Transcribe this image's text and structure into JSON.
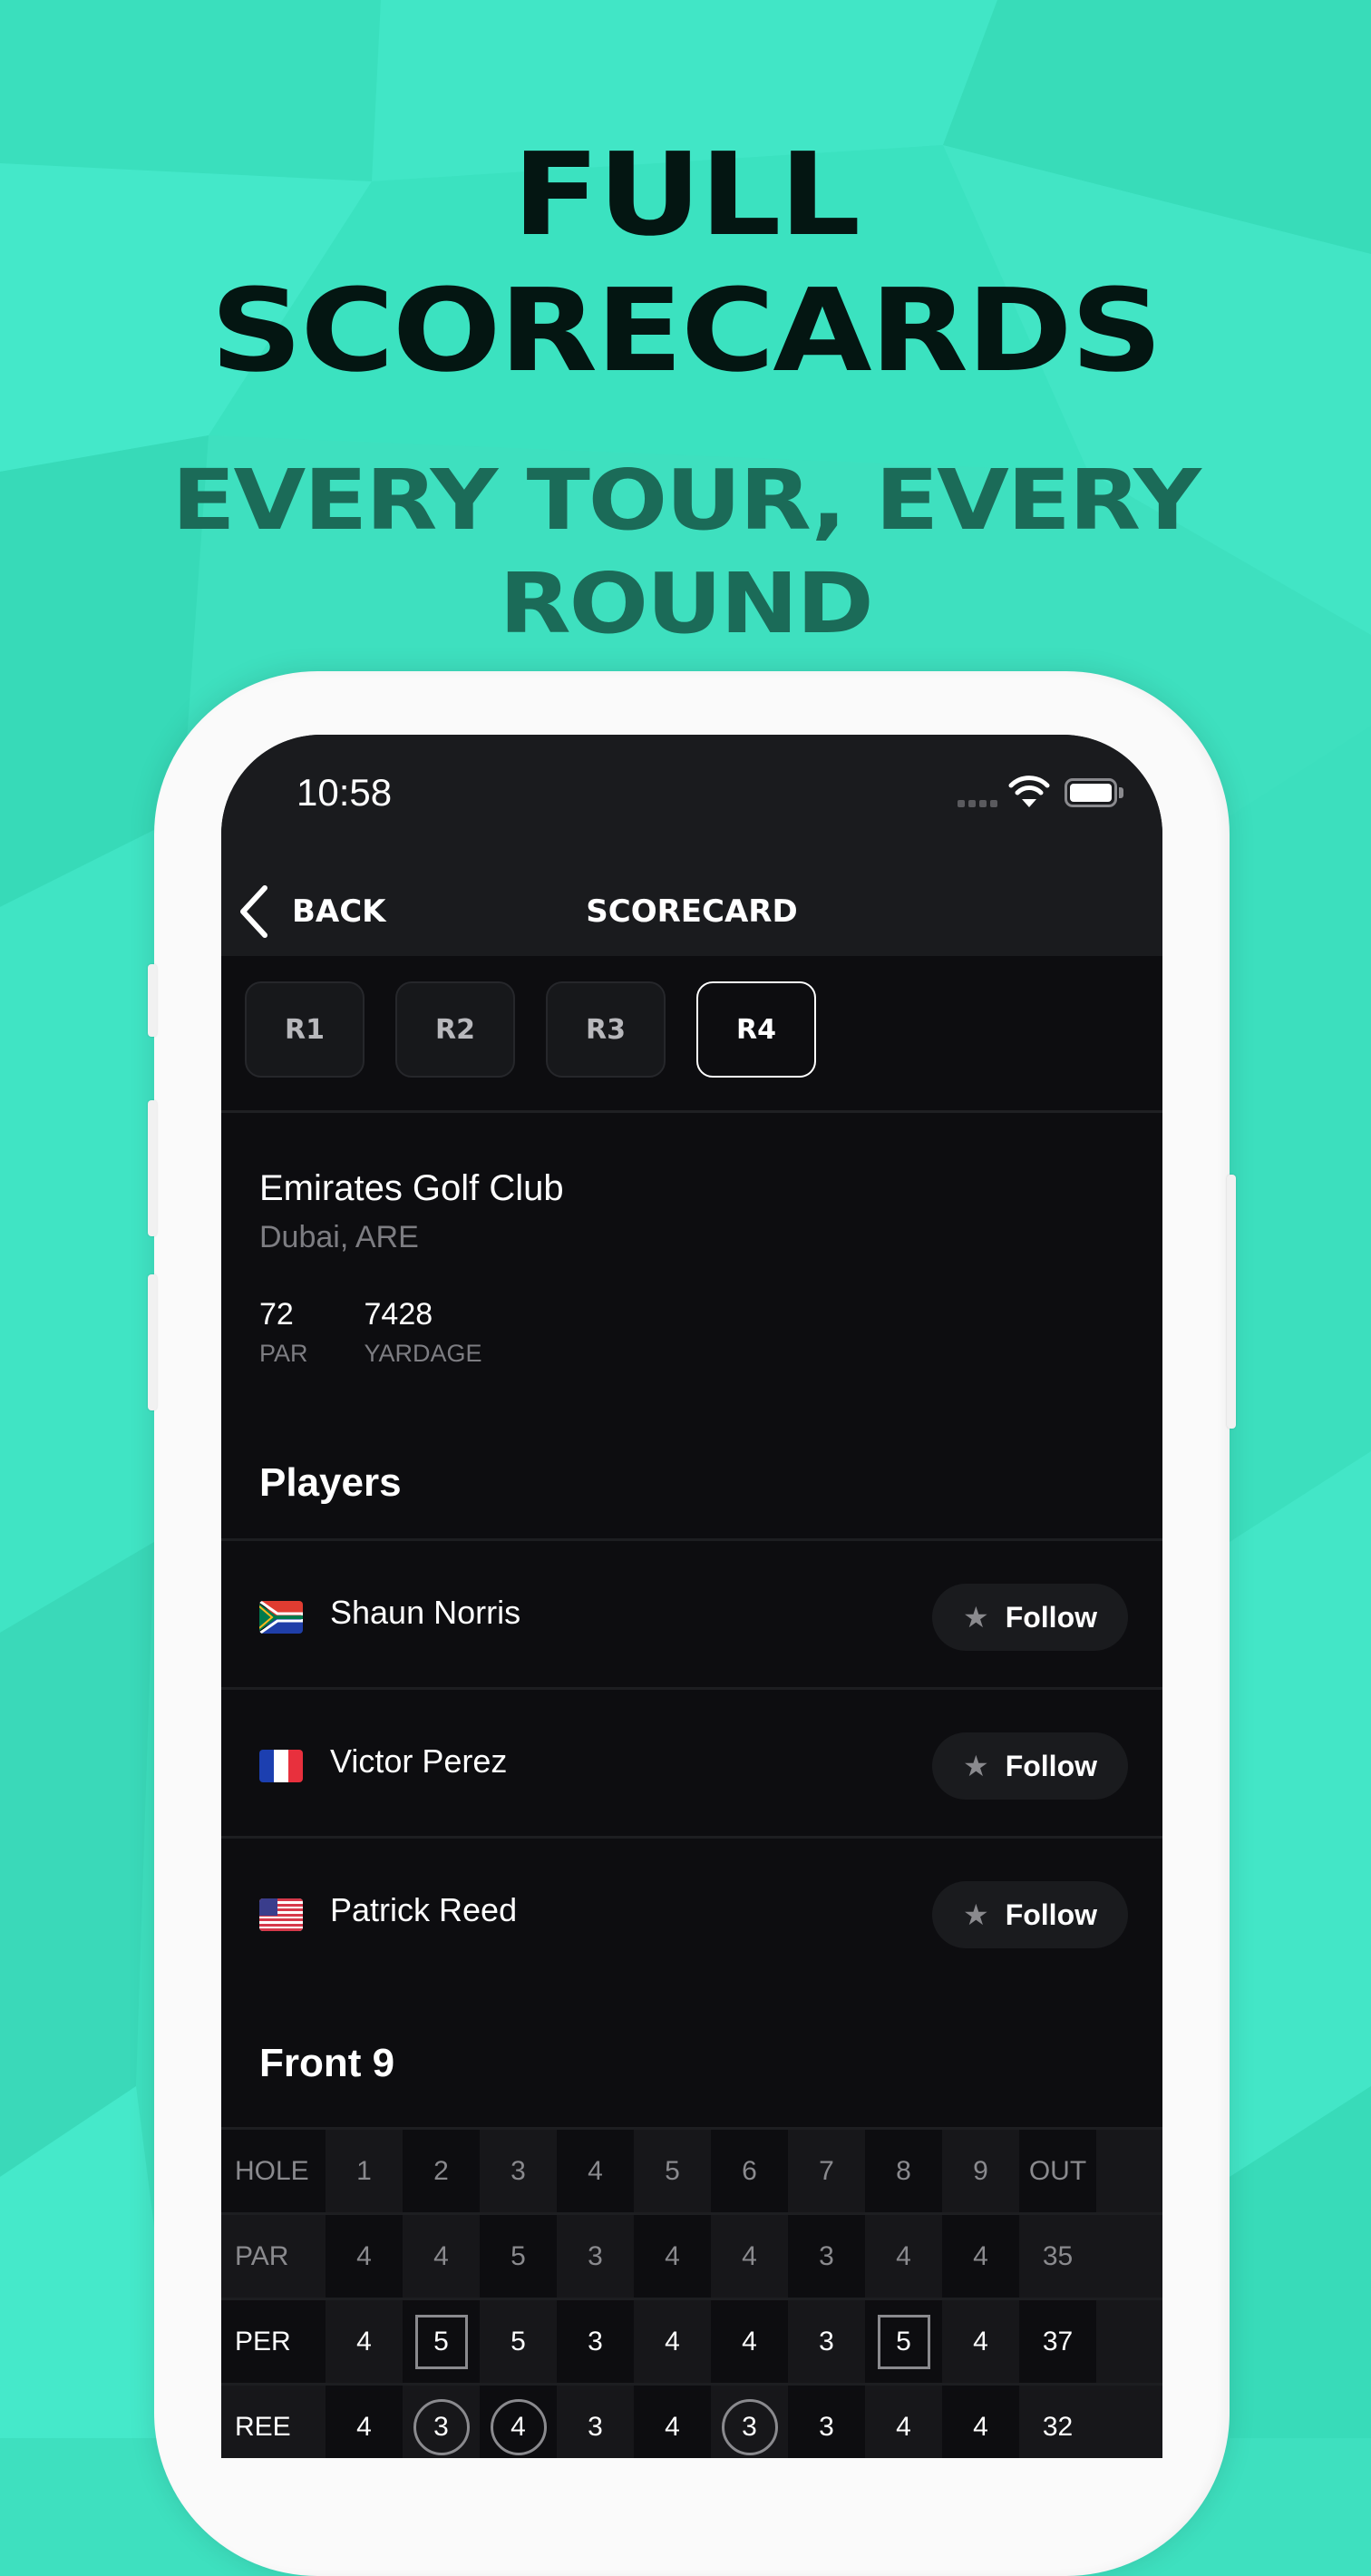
{
  "promo": {
    "headline_line1": "FULL",
    "headline_line2": "SCORECARDS",
    "subhead_line1": "EVERY TOUR, EVERY",
    "subhead_line2": "ROUND",
    "background_color": "#3ee0bf",
    "headline_color": "#041612",
    "subhead_color": "#1b6b58"
  },
  "status_bar": {
    "time": "10:58",
    "icons": [
      "signal-dots-icon",
      "wifi-icon",
      "battery-icon"
    ]
  },
  "nav": {
    "back_label": "BACK",
    "title": "SCORECARD"
  },
  "rounds": {
    "items": [
      {
        "label": "R1",
        "active": false
      },
      {
        "label": "R2",
        "active": false
      },
      {
        "label": "R3",
        "active": false
      },
      {
        "label": "R4",
        "active": true
      }
    ]
  },
  "course": {
    "name": "Emirates Golf Club",
    "location": "Dubai, ARE",
    "par_value": "72",
    "par_label": "PAR",
    "yardage_value": "7428",
    "yardage_label": "YARDAGE"
  },
  "players": {
    "title": "Players",
    "items": [
      {
        "name": "Shaun Norris",
        "flag": "south-africa",
        "follow_label": "Follow"
      },
      {
        "name": "Victor Perez",
        "flag": "france",
        "follow_label": "Follow"
      },
      {
        "name": "Patrick Reed",
        "flag": "usa",
        "follow_label": "Follow"
      }
    ]
  },
  "scorecard": {
    "title": "Front 9",
    "rows": [
      {
        "label": "HOLE",
        "style": "gray",
        "cells": [
          "1",
          "2",
          "3",
          "4",
          "5",
          "6",
          "7",
          "8",
          "9"
        ],
        "total": "OUT",
        "marks": [
          "",
          "",
          "",
          "",
          "",
          "",
          "",
          "",
          ""
        ]
      },
      {
        "label": "PAR",
        "style": "gray",
        "cells": [
          "4",
          "4",
          "5",
          "3",
          "4",
          "4",
          "3",
          "4",
          "4"
        ],
        "total": "35",
        "marks": [
          "",
          "",
          "",
          "",
          "",
          "",
          "",
          "",
          ""
        ]
      },
      {
        "label": "PER",
        "style": "white",
        "cells": [
          "4",
          "5",
          "5",
          "3",
          "4",
          "4",
          "3",
          "5",
          "4"
        ],
        "total": "37",
        "marks": [
          "",
          "bogey",
          "",
          "",
          "",
          "",
          "",
          "bogey",
          ""
        ]
      },
      {
        "label": "REE",
        "style": "white",
        "cells": [
          "4",
          "3",
          "4",
          "3",
          "4",
          "3",
          "3",
          "4",
          "4"
        ],
        "total": "32",
        "marks": [
          "",
          "birdie",
          "birdie",
          "",
          "",
          "birdie",
          "",
          "",
          ""
        ]
      }
    ]
  }
}
